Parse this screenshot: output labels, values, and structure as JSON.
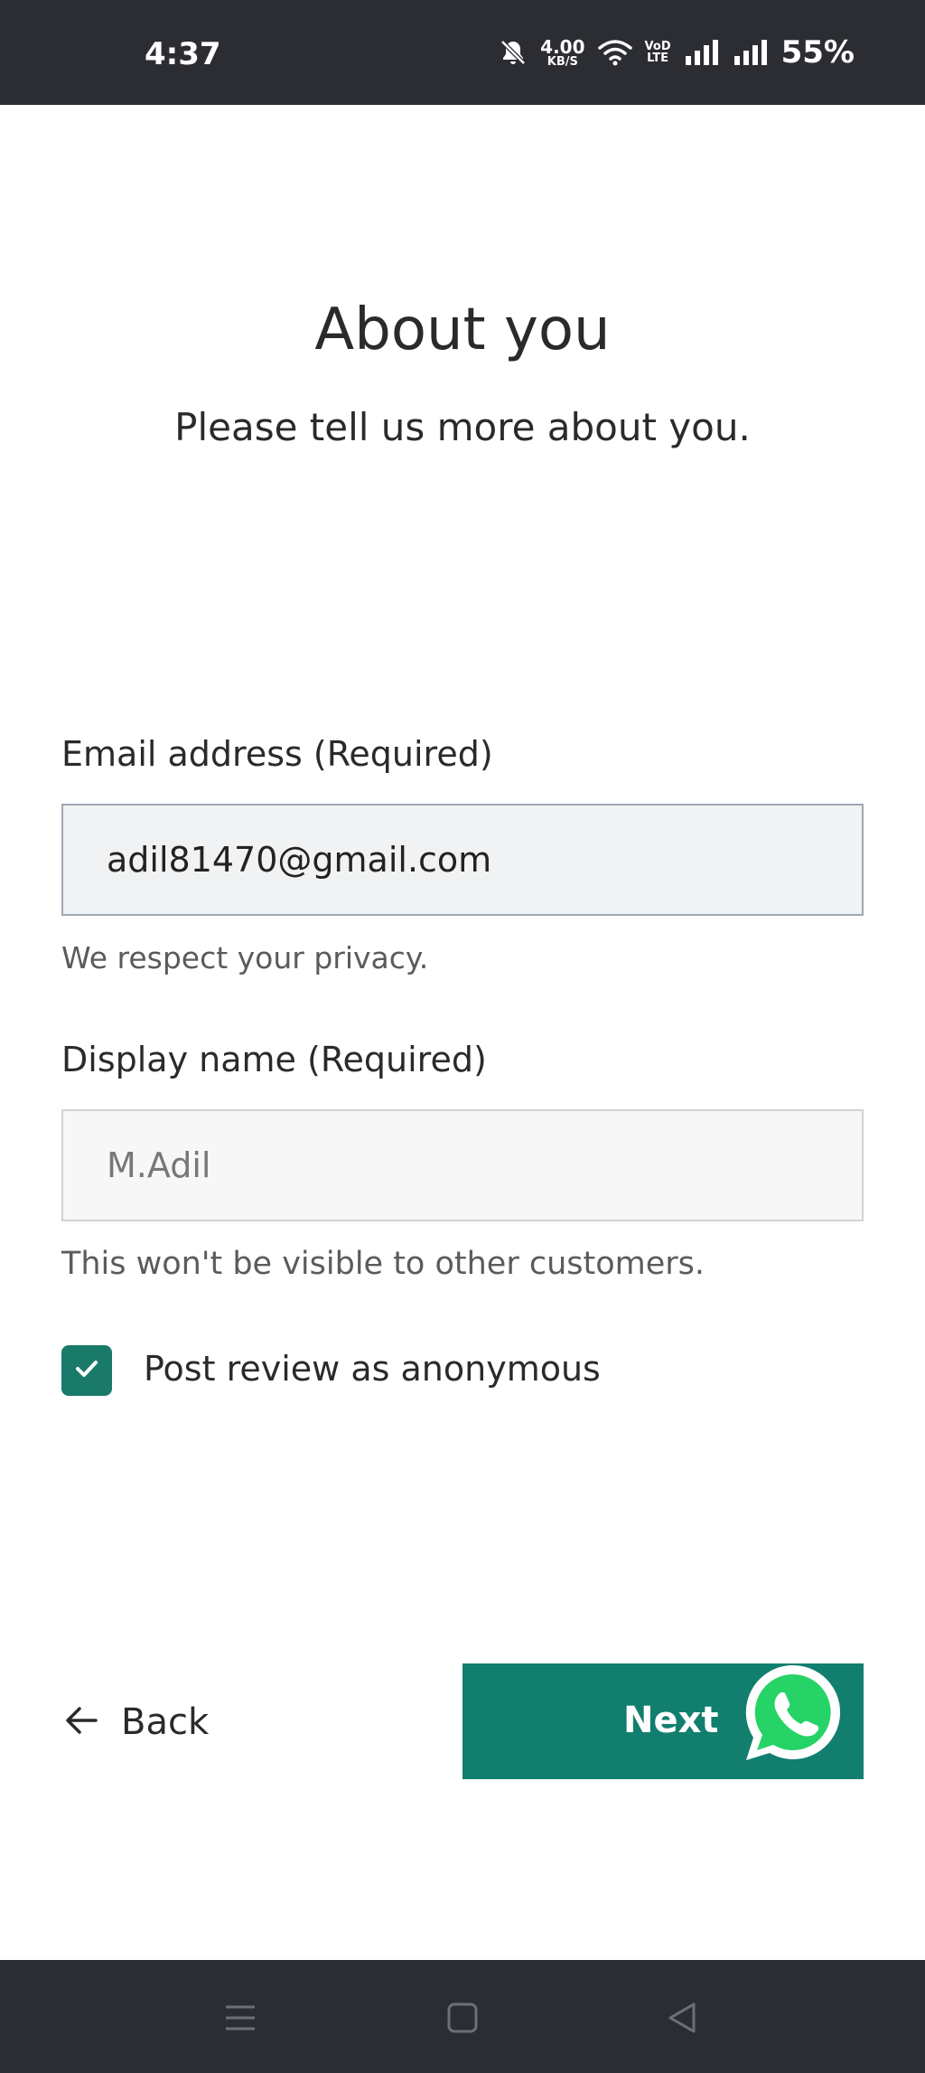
{
  "status_bar": {
    "time": "4:37",
    "net_speed_value": "4.00",
    "net_speed_unit": "KB/S",
    "volte_top": "VoD",
    "volte_bottom": "LTE",
    "battery": "55%",
    "icons": [
      "mute-bell-icon",
      "wifi-icon",
      "signal-icon",
      "signal-icon"
    ]
  },
  "header": {
    "title": "About you",
    "subtitle": "Please tell us more about you."
  },
  "form": {
    "email": {
      "label": "Email address (Required)",
      "value": "adil81470@gmail.com",
      "helper": "We respect your privacy."
    },
    "display_name": {
      "label": "Display name (Required)",
      "placeholder": "M.Adil",
      "helper": "This won't be visible to other customers."
    },
    "anonymous": {
      "label": "Post review as anonymous",
      "checked": true
    }
  },
  "actions": {
    "back_label": "Back",
    "next_label": "Next"
  },
  "colors": {
    "accent": "#127f6e",
    "checkbox": "#1a7a6a",
    "system_bars": "#2b2d33",
    "whatsapp": "#25d366"
  },
  "nav_bar": {
    "icons": [
      "menu-icon",
      "home-icon",
      "back-triangle-icon"
    ]
  }
}
